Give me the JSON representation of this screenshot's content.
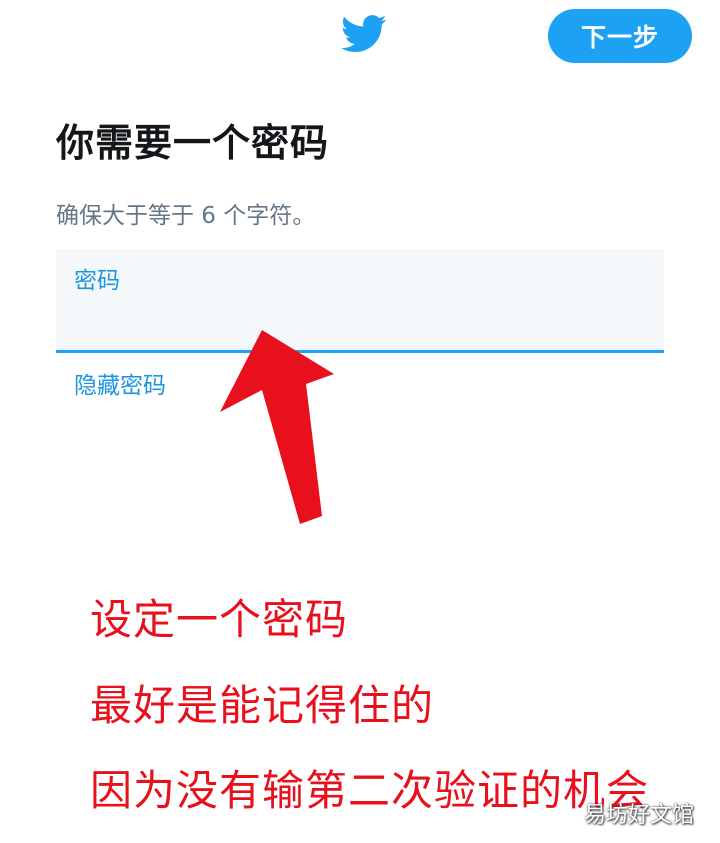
{
  "header": {
    "logo_icon": "twitter-bird-icon",
    "next_label": "下一步"
  },
  "main": {
    "title": "你需要一个密码",
    "subtitle": "确保大于等于 6 个字符。",
    "password_field": {
      "label": "密码",
      "value": ""
    },
    "hide_password_label": "隐藏密码"
  },
  "annotation": {
    "arrow_icon": "red-arrow-up-icon",
    "lines": [
      "设定一个密码",
      "最好是能记得住的",
      "因为没有输第二次验证的机会"
    ]
  },
  "watermark": "易坊好文馆",
  "colors": {
    "brand": "#1da1f2",
    "link": "#1b95e0",
    "annotation": "#e8101c"
  }
}
